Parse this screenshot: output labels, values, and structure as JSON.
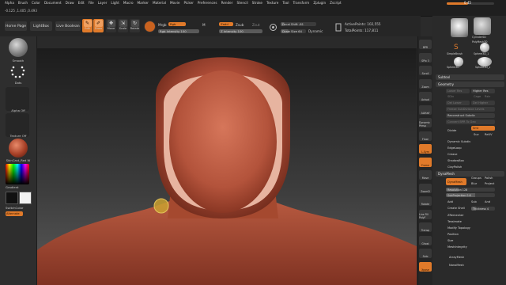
{
  "menu": {
    "items": [
      "Alpha",
      "Brush",
      "Color",
      "Document",
      "Draw",
      "Edit",
      "File",
      "Layer",
      "Light",
      "Macro",
      "Marker",
      "Material",
      "Movie",
      "Picker",
      "Preferences",
      "Render",
      "Stencil",
      "Stroke",
      "Texture",
      "Tool",
      "Transform",
      "Zplugin",
      "Zscript"
    ],
    "coords": "-0.125 ,1.405 ,0.493"
  },
  "top_right": {
    "slider_label": "0.45",
    "slider_value": 0.45
  },
  "toolbar": {
    "home_page": "Home Page",
    "lightbox": "LightBox",
    "live_boolean": "Live Boolean",
    "edit": "Edit",
    "draw": "Draw",
    "move": "Move",
    "scale": "Scale",
    "rotate": "Rotate",
    "mrgb": "Mrgb",
    "rgb": "Rgb",
    "m": "M",
    "zadd": "Zadd",
    "zsub": "Zsub",
    "zcut": "Zcut",
    "rgb_intensity": "Rgb Intensity 100",
    "z_intensity": "Z Intensity 100",
    "focal_shift": "Focal Shift -81",
    "draw_size": "Draw Size 64",
    "dynamic": "Dynamic",
    "active_points": "ActivePoints: 102,555",
    "total_points": "TotalPoints: 117,811",
    "focal_shift_value": 0.1,
    "draw_size_value": 0.3,
    "rgb_intensity_value": 1.0,
    "z_intensity_value": 1.0
  },
  "left_panel": {
    "brush_label": "Smooth",
    "stroke_label": "Dots",
    "alpha_label": "Alpha Off",
    "texture_label": "Texture Off",
    "material_label": "SkinCast_Red W",
    "gradient_label": "Gradient",
    "switch_color": "SwitchColor",
    "alternate": "Alternate"
  },
  "right_strip": {
    "buttons": [
      "BPR",
      "SPix 3",
      "Scroll",
      "Zoom",
      "Actual",
      "AAHalf",
      "Dynamic Persp",
      "Floor",
      "L.Sym",
      "Frame",
      "Move",
      "ZoomD",
      "Rotate",
      "Line Fill PolyF",
      "Transp",
      "Ghost",
      "Solo",
      "Xpose"
    ]
  },
  "right_panel": {
    "tool_slider": "0.45",
    "tools": [
      {
        "name": "CylinderSD"
      },
      {
        "name": "PolyMesh3D"
      },
      {
        "name": "SimpleBrush"
      },
      {
        "name": "Sphere3D_1"
      },
      {
        "name": "Sphere3D"
      },
      {
        "name": "Sphere3D_1"
      }
    ],
    "subtool": "Subtool",
    "geometry": "Geometry",
    "lower_res": "Lower Res",
    "higher_res": "Higher Res",
    "sdiv": "SDiv",
    "cage": "Cage",
    "rstr": "Rstr",
    "del_lower": "Del Lower",
    "del_higher": "Del Higher",
    "freeze_subdiv": "Freeze SubDivision Levels",
    "reconstruct": "Reconstruct Subdiv",
    "convert_bpr": "Convert BPR To Geo",
    "divide": "Divide",
    "smt": "Smt",
    "suv": "Suv",
    "rsuv": "ReUV",
    "dynamic_subdiv": "Dynamic Subdiv",
    "edgeloop": "EdgeLoop",
    "crease": "Crease",
    "shadowbox": "ShadowBox",
    "claypolish": "ClayPolish",
    "dynamesh_header": "DynaMesh",
    "dynamesh_btn": "DynaMesh",
    "groups": "Groups",
    "polish": "Polish",
    "blur": "Blur",
    "project": "Project",
    "resolution": "Resolution 128",
    "resolution_value": 0.25,
    "subprojection": "SubProjection 0.6",
    "subprojection_value": 0.6,
    "add": "Add",
    "sub": "Sub",
    "and": "And",
    "create_shell": "Create Shell",
    "thickness": "Thickness 4",
    "thickness_value": 0.2,
    "zremesher": "ZRemesher",
    "tessimate": "Tessimate",
    "modify_topology": "Modify Topology",
    "position": "Position",
    "size": "Size",
    "meshintegrity": "MeshIntegrity",
    "arraymesh": "ArrayMesh",
    "nanomesh": "NanoMesh"
  },
  "colors": {
    "accent": "#e07a2a",
    "clay": "#b5533a",
    "background": "#2b2b2b"
  }
}
